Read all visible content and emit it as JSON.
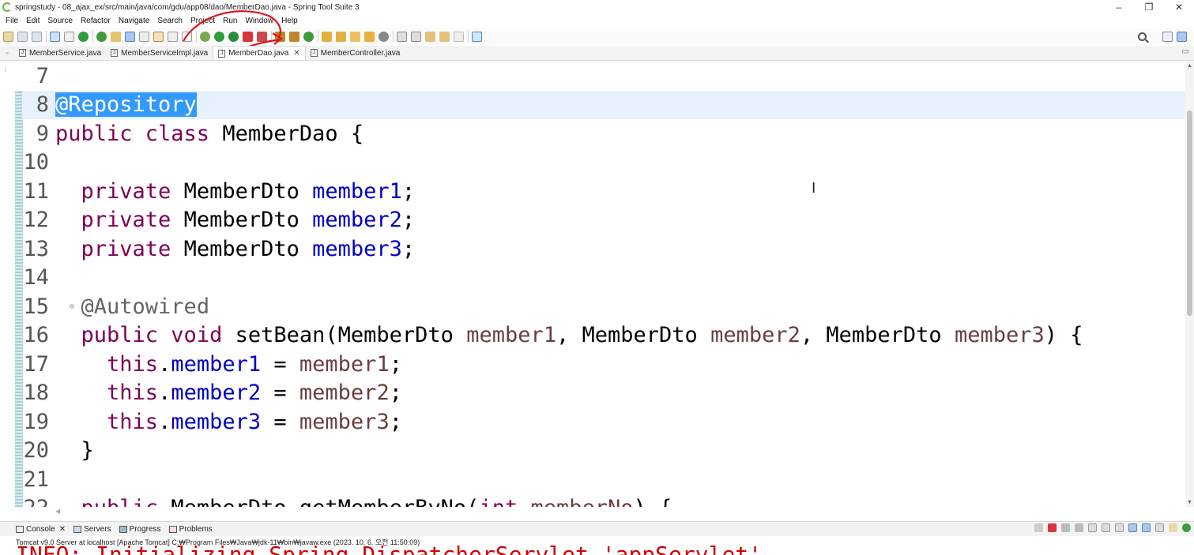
{
  "window": {
    "title": "springstudy - 08_ajax_ex/src/main/java/com/gdu/app08/dao/MemberDao.java - Spring Tool Suite 3",
    "minimize": "–",
    "restore": "❐",
    "close": "✕"
  },
  "menu": [
    "File",
    "Edit",
    "Source",
    "Refactor",
    "Navigate",
    "Search",
    "Project",
    "Run",
    "Window",
    "Help"
  ],
  "tabs": [
    {
      "label": "MemberService.java",
      "active": false
    },
    {
      "label": "MemberServiceImpl.java",
      "active": false
    },
    {
      "label": "MemberDao.java",
      "active": true,
      "close": "✕"
    },
    {
      "label": "MemberController.java",
      "active": false
    }
  ],
  "tabbar_minmax": "▭",
  "editor": {
    "lines": [
      {
        "n": "7"
      },
      {
        "n": "8",
        "t1": "@Repository"
      },
      {
        "n": "9",
        "t1": "public class",
        "t2": " MemberDao {"
      },
      {
        "n": "10"
      },
      {
        "n": "11",
        "kw": "private",
        "type": " MemberDto ",
        "fld": "member1",
        "end": ";"
      },
      {
        "n": "12",
        "kw": "private",
        "type": " MemberDto ",
        "fld": "member2",
        "end": ";"
      },
      {
        "n": "13",
        "kw": "private",
        "type": " MemberDto ",
        "fld": "member3",
        "end": ";"
      },
      {
        "n": "14"
      },
      {
        "n": "15",
        "ann": "@Autowired",
        "fold": "⊖"
      },
      {
        "n": "16",
        "kw": "public void",
        "a": " setBean(MemberDto ",
        "p1": "member1",
        "b": ", MemberDto ",
        "p2": "member2",
        "c": ", MemberDto ",
        "p3": "member3",
        "d": ") {"
      },
      {
        "n": "17",
        "kw": "this",
        "dot": ".",
        "fld": "member1",
        "eq": " = ",
        "prm": "member1",
        "end": ";"
      },
      {
        "n": "18",
        "kw": "this",
        "dot": ".",
        "fld": "member2",
        "eq": " = ",
        "prm": "member2",
        "end": ";"
      },
      {
        "n": "19",
        "kw": "this",
        "dot": ".",
        "fld": "member3",
        "eq": " = ",
        "prm": "member3",
        "end": ";"
      },
      {
        "n": "20",
        "t": "}"
      },
      {
        "n": "21"
      },
      {
        "n": "22",
        "kw": "public",
        "a": " MemberDto getMemberByNo(",
        "kw2": "int",
        "prm": " memberNo",
        "d": ") {"
      }
    ]
  },
  "console": {
    "tabs": [
      {
        "label": "Console",
        "close": "✕"
      },
      {
        "label": "Servers"
      },
      {
        "label": "Progress"
      },
      {
        "label": "Problems"
      }
    ],
    "description": "Tomcat v9.0 Server at localhost [Apache Tomcat] C:₩Program Files₩Java₩jdk-11₩bin₩javaw.exe  (2023. 10. 6. 오전 11:50:09)",
    "output": "INFO: Initializing Spring DispatcherServlet 'appServlet'"
  }
}
